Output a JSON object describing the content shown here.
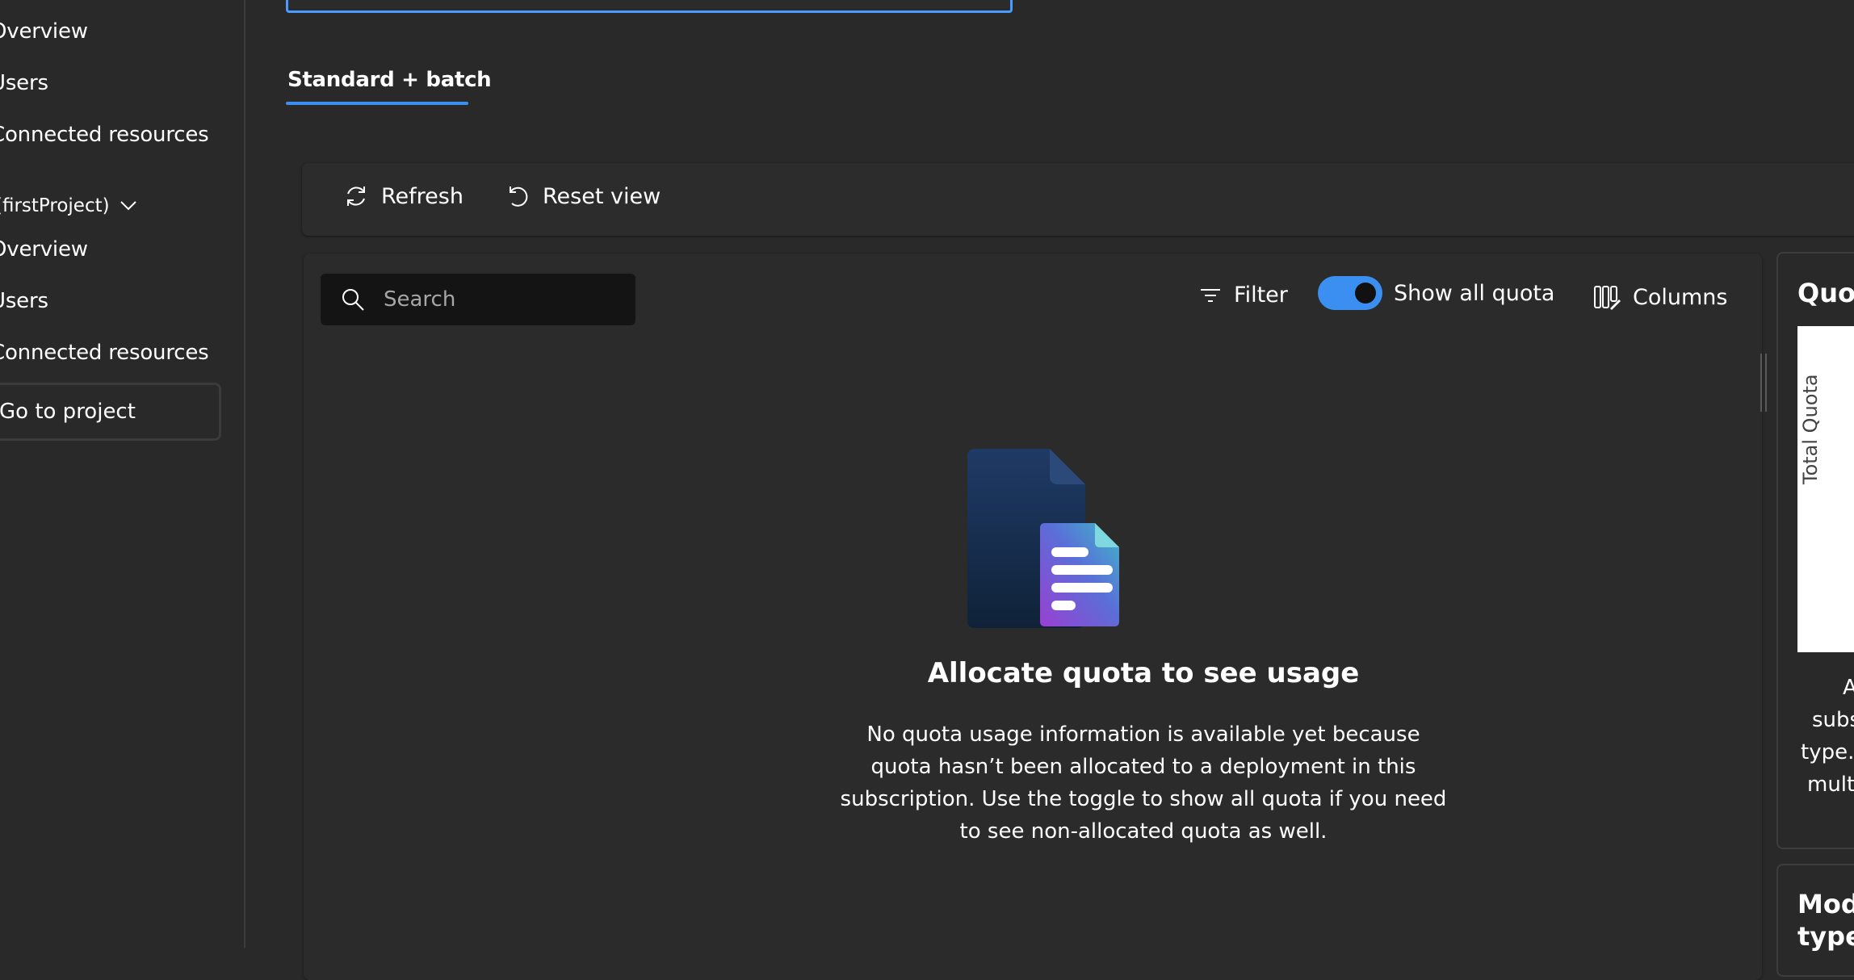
{
  "sidebar": {
    "items": [
      {
        "label": "Overview"
      },
      {
        "label": "Users"
      },
      {
        "label": "Connected resources"
      }
    ],
    "project_group": "(firstProject)",
    "project_items": [
      {
        "label": "Overview"
      },
      {
        "label": "Users"
      },
      {
        "label": "Connected resources"
      }
    ],
    "go_to_project": "Go to project"
  },
  "tabs": [
    {
      "label": "Standard + batch",
      "selected": true
    }
  ],
  "toolbar": {
    "refresh_label": "Refresh",
    "reset_view_label": "Reset view"
  },
  "grid": {
    "search_placeholder": "Search",
    "filter_label": "Filter",
    "show_all_quota_label": "Show all quota",
    "show_all_quota_on": true,
    "columns_label": "Columns"
  },
  "empty_state": {
    "title": "Allocate quota to see usage",
    "description_lines": [
      "No quota usage information is available yet because",
      "quota hasn’t been allocated to a deployment in this",
      "subscription. Use the toggle to show all quota if you need",
      "to see non-allocated quota as well."
    ]
  },
  "right_card": {
    "title": "Quota",
    "chart_ylabel": "Total Quota",
    "text_lines": [
      "A",
      "subs",
      "type.",
      "multi"
    ]
  },
  "right_card2": {
    "title": "Model types"
  },
  "colors": {
    "accent": "#3b8ff0",
    "background": "#292929",
    "search_bg": "#141414"
  }
}
